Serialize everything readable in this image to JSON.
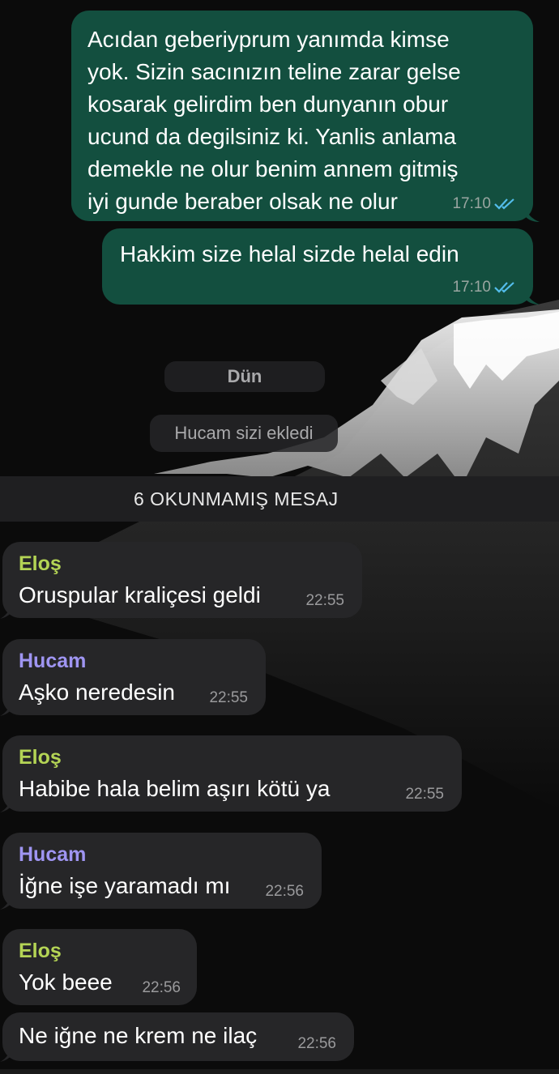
{
  "messages_out": [
    {
      "text": "Acıdan geberiyprum yanımda kimse\nyok. Sizin sacınızın teline zarar gelse\nkosarak gelirdim ben dunyanın obur\nucund da degilsiniz ki. Yanlis anlama\ndemekle ne olur benim annem gitmiş\niyi gunde beraber olsak ne olur",
      "time": "17:10"
    },
    {
      "text": "Hakkim size helal sizde helal edin",
      "time": "17:10"
    }
  ],
  "date_separator": "Dün",
  "system_message": "Hucam sizi ekledi",
  "unread_banner": "6 OKUNMAMIŞ MESAJ",
  "messages_in": [
    {
      "sender": "Eloş",
      "text": "Oruspular kraliçesi geldi",
      "time": "22:55"
    },
    {
      "sender": "Hucam",
      "text": "Aşko neredesin",
      "time": "22:55"
    },
    {
      "sender": "Eloş",
      "text": "Habibe hala belim aşırı kötü ya",
      "time": "22:55"
    },
    {
      "sender": "Hucam",
      "text": "İğne işe yaramadı mı",
      "time": "22:56"
    },
    {
      "sender": "Eloş",
      "text": "Yok beee",
      "time": "22:56"
    },
    {
      "sender": "",
      "text": "Ne iğne ne krem ne ilaç",
      "time": "22:56"
    }
  ],
  "colors": {
    "outgoing_bubble": "#134f3f",
    "incoming_bubble": "#262628",
    "sender_elos": "#b4d455",
    "sender_hucam": "#9f95f2",
    "read_ticks": "#53bdeb"
  }
}
